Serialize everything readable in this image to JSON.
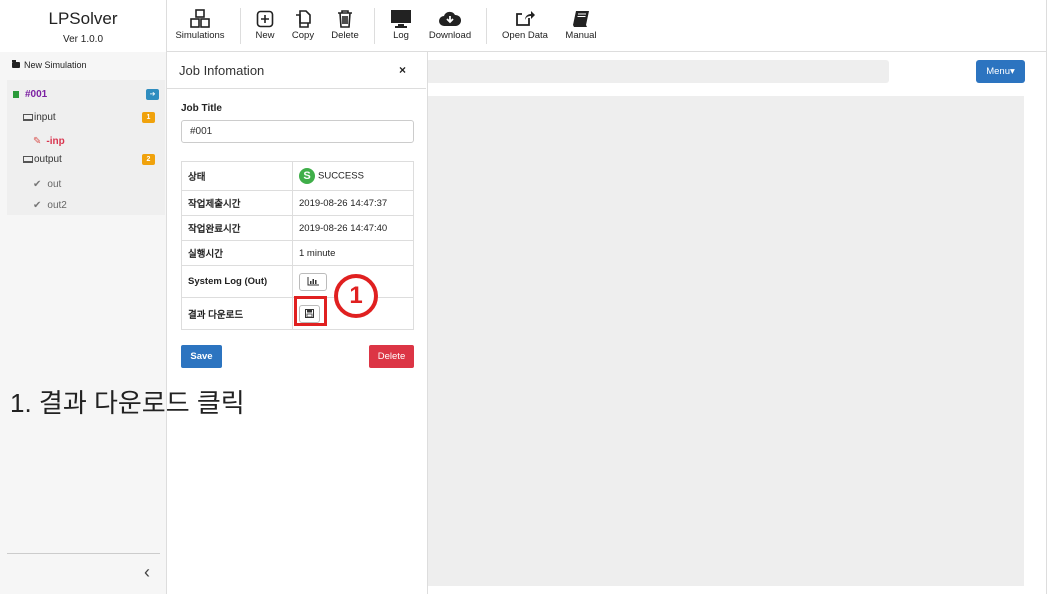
{
  "brand": {
    "name": "LPSolver",
    "version": "Ver 1.0.0"
  },
  "toolbar": {
    "simulations": "Simulations",
    "new": "New",
    "copy": "Copy",
    "delete": "Delete",
    "log": "Log",
    "download": "Download",
    "open_data": "Open Data",
    "manual": "Manual"
  },
  "sidebar": {
    "new_simulation": "New Simulation",
    "job": {
      "id": "#001",
      "badge": "➔"
    },
    "input": {
      "label": "input",
      "badge": "1",
      "child": "-inp"
    },
    "output": {
      "label": "output",
      "badge": "2",
      "children": [
        "out",
        "out2"
      ]
    },
    "collapse_glyph": "‹"
  },
  "main": {
    "menu_label": "Menu▾"
  },
  "panel": {
    "title": "Job Infomation",
    "close": "×",
    "job_title_label": "Job Title",
    "job_title_value": "#001",
    "rows": [
      {
        "key": "상태",
        "value": "SUCCESS",
        "status_letter": "S"
      },
      {
        "key": "작업제출시간",
        "value": "2019-08-26 14:47:37"
      },
      {
        "key": "작업완료시간",
        "value": "2019-08-26 14:47:40"
      },
      {
        "key": "실행시간",
        "value": "1 minute"
      },
      {
        "key": "System Log (Out)",
        "value": ""
      },
      {
        "key": "결과 다운로드",
        "value": ""
      }
    ],
    "save": "Save",
    "delete": "Delete"
  },
  "annotation": {
    "marker": "1",
    "caption": "1. 결과 다운로드 클릭"
  },
  "colors": {
    "primary": "#2c74c0",
    "danger": "#dc3545",
    "success": "#3fae49",
    "highlight": "#e02020",
    "job_id": "#7b1fa2"
  }
}
